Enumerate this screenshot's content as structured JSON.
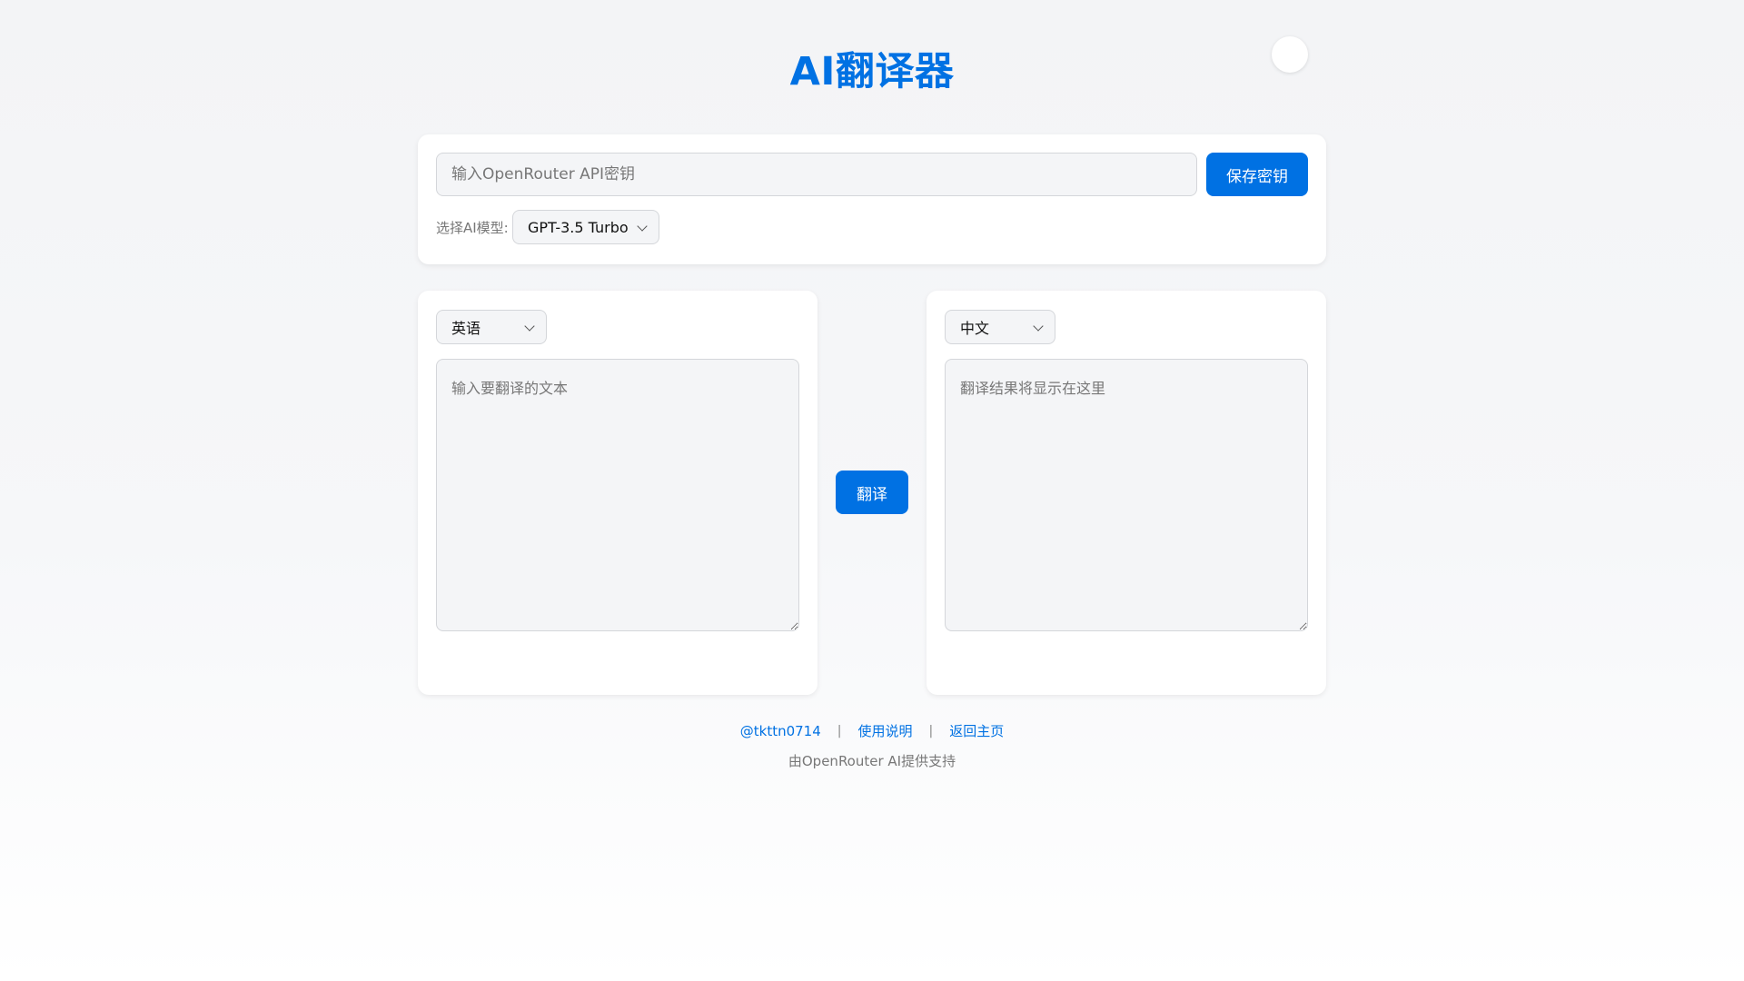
{
  "header": {
    "title": "AI翻译器"
  },
  "config": {
    "api_key_placeholder": "输入OpenRouter API密钥",
    "api_key_value": "",
    "save_label": "保存密钥",
    "model_label": "选择AI模型:",
    "model_selected": "GPT-3.5 Turbo"
  },
  "source": {
    "language": "英语",
    "placeholder": "输入要翻译的文本"
  },
  "translate_label": "翻译",
  "target": {
    "language": "中文",
    "placeholder": "翻译结果将显示在这里"
  },
  "footer": {
    "links": [
      {
        "label": "@tkttn0714"
      },
      {
        "label": "使用说明"
      },
      {
        "label": "返回主页"
      }
    ],
    "separator": "|",
    "credit": "由OpenRouter AI提供支持"
  },
  "colors": {
    "accent": "#0071e3",
    "background": "#f3f4f6",
    "card": "#ffffff"
  }
}
